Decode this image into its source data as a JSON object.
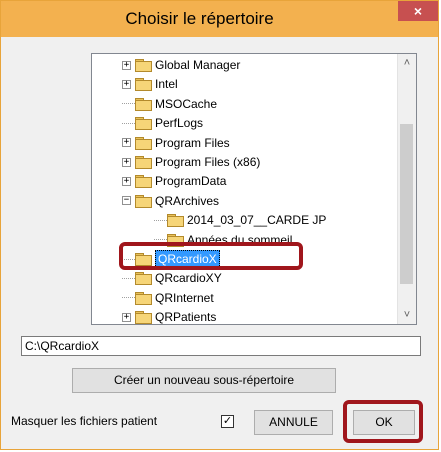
{
  "window": {
    "title": "Choisir le répertoire",
    "close_glyph": "×"
  },
  "tree": {
    "items": [
      {
        "label": "Global Manager",
        "expandable": true,
        "expander": "+"
      },
      {
        "label": "Intel",
        "expandable": true,
        "expander": "+"
      },
      {
        "label": "MSOCache",
        "expandable": false
      },
      {
        "label": "PerfLogs",
        "expandable": false
      },
      {
        "label": "Program Files",
        "expandable": true,
        "expander": "+"
      },
      {
        "label": "Program Files (x86)",
        "expandable": true,
        "expander": "+"
      },
      {
        "label": "ProgramData",
        "expandable": true,
        "expander": "+"
      },
      {
        "label": "QRArchives",
        "expandable": true,
        "expander": "−"
      },
      {
        "label": "2014_03_07__CARDE JP",
        "expandable": false
      },
      {
        "label": "Années du sommeil",
        "expandable": false
      },
      {
        "label": "QRcardioX",
        "expandable": false,
        "selected": true
      },
      {
        "label": "QRcardioXY",
        "expandable": false
      },
      {
        "label": "QRInternet",
        "expandable": false
      },
      {
        "label": "QRPatients",
        "expandable": true,
        "expander": "+"
      }
    ],
    "scroll_up_icon": "chevron-up",
    "scroll_down_icon": "chevron-down"
  },
  "path": {
    "value": "C:\\QRcardioX"
  },
  "buttons": {
    "create_label": "Créer un nouveau sous-répertoire",
    "cancel_label": "ANNULE",
    "ok_label": "OK"
  },
  "mask": {
    "label": "Masquer les fichiers patient",
    "checked": true,
    "check_glyph": "✓"
  },
  "colors": {
    "title_bar": "#f3b14f",
    "close_button": "#c75050",
    "selection": "#3399ff",
    "highlight_box": "#a0161c"
  }
}
